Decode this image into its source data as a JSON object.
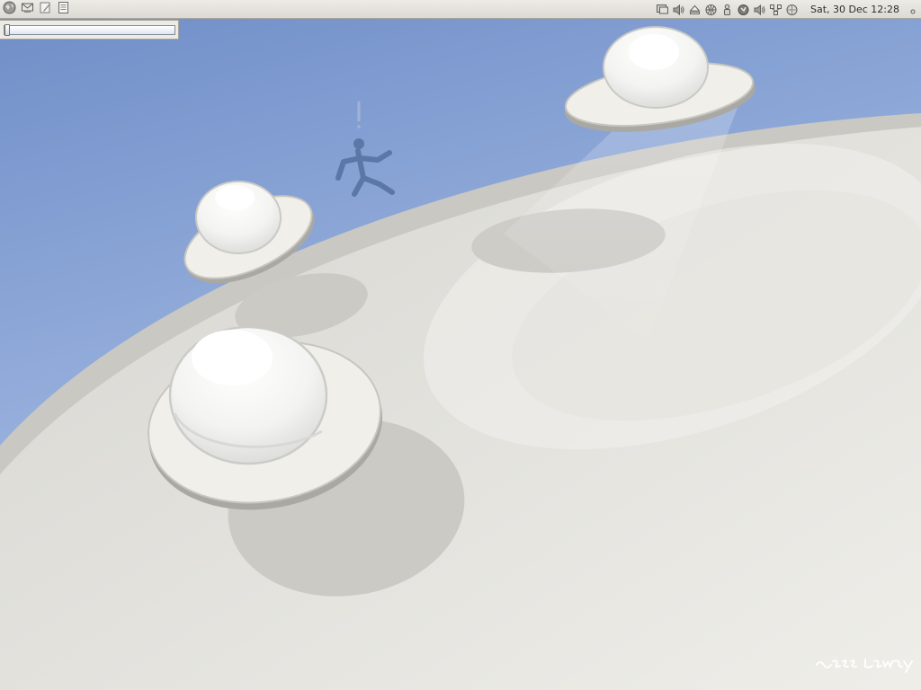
{
  "panel": {
    "launchers": [
      {
        "icon": "web-browser-icon"
      },
      {
        "icon": "email-client-icon"
      },
      {
        "icon": "text-editor-icon"
      },
      {
        "icon": "document-viewer-icon"
      }
    ],
    "tray_icons": [
      "display-settings-icon",
      "volume-icon",
      "eject-icon",
      "network-globe-icon",
      "user-switcher-icon",
      "software-update-icon",
      "volume-icon",
      "network-status-icon",
      "desktop-switcher-icon"
    ],
    "clock": "Sat, 30 Dec 12:28"
  },
  "progress_window": {
    "progress_fraction": 0.0
  },
  "wallpaper": {
    "sky_top": "#7b98cf",
    "sky_bottom": "#a7bee6",
    "planet": "#dcdbd6",
    "ufo": "#f0efea",
    "figure": "#5875a6",
    "signature_text": "russ lawrey"
  }
}
